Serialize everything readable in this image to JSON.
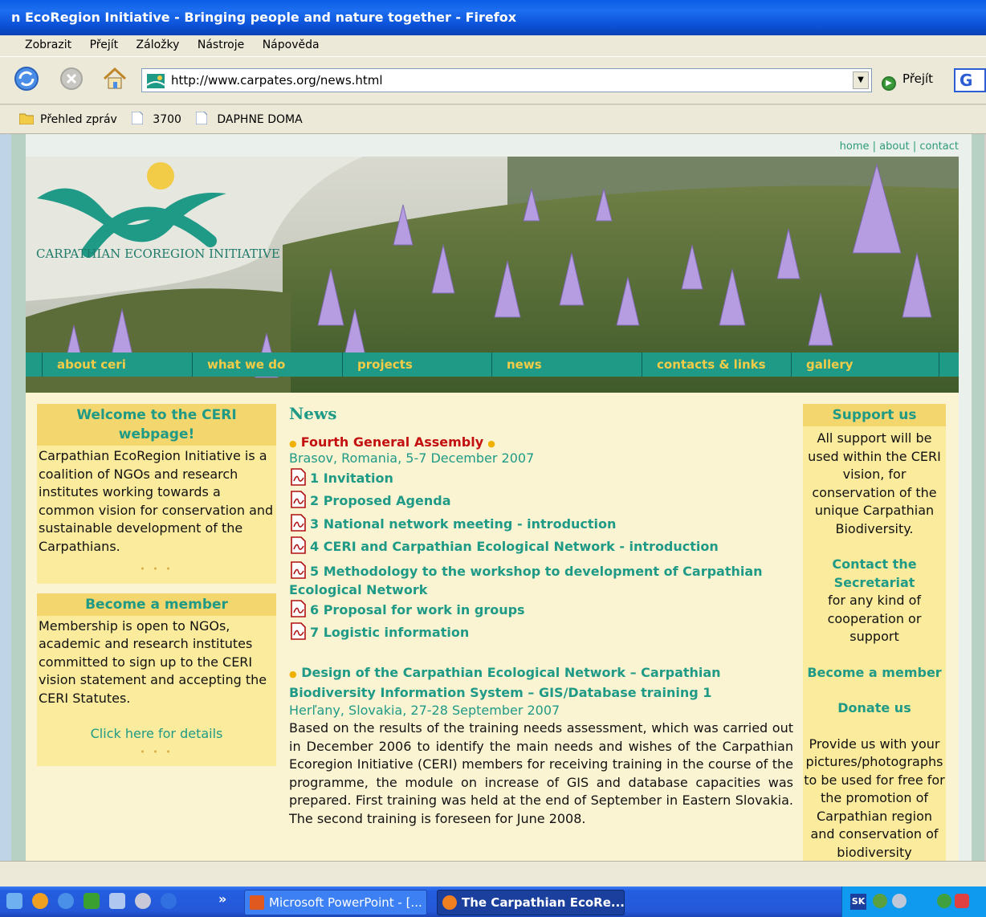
{
  "window": {
    "title": "n EcoRegion Initiative - Bringing people and nature together - Firefox"
  },
  "menu": [
    "Zobrazit",
    "Přejít",
    "Záložky",
    "Nástroje",
    "Nápověda"
  ],
  "toolbar": {
    "url": "http://www.carpates.org/news.html",
    "go_label": "Přejít",
    "google_label": "G"
  },
  "bookmarks": [
    "Přehled zpráv",
    "3700",
    "DAPHNE DOMA"
  ],
  "site": {
    "toplinks": {
      "home": "home",
      "sep1": " | ",
      "about": "about",
      "sep2": " | ",
      "contact": "contact"
    },
    "logo_text": "Carpathian EcoRegion Initiative",
    "tabs": [
      "about ceri",
      "what we do",
      "projects",
      "news",
      "contacts & links",
      "gallery"
    ],
    "welcome": {
      "title": "Welcome to the CERI webpage!",
      "text": "Carpathian EcoRegion Initiative is a coalition of NGOs and research institutes working towards a common vision for conservation and sustainable development of the Carpathians.",
      "dots": "• • •"
    },
    "member": {
      "title": "Become a member",
      "text": "Membership is open to NGOs, academic and research institutes committed to sign up to the CERI vision statement and accepting the CERI Statutes.",
      "link": "Click here for details",
      "dots": "• • •"
    },
    "news": {
      "title": "News",
      "item1": {
        "headline": "Fourth General Assembly",
        "place": "Brasov, Romania, 5-7 December 2007",
        "docs": [
          "1 Invitation",
          "2 Proposed Agenda",
          "3 National network meeting - introduction",
          "4 CERI and Carpathian Ecological Network - introduction",
          "5 Methodology to the workshop to development of Carpathian Ecological Network",
          "6 Proposal for work in groups",
          "7 Logistic information"
        ]
      },
      "item2": {
        "headline": "Design of the Carpathian Ecological Network – Carpathian Biodiversity Information System – GIS/Database training 1",
        "place": "Herľany, Slovakia, 27-28 September 2007",
        "text": "Based on the results of the training needs assessment, which was carried out in December 2006 to identify the main needs and wishes of the Carpathian Ecoregion Initiative (CERI) members for receiving training in the course of the programme, the module on increase of GIS and database capacities was prepared. First training was held at the end of September in Eastern Slovakia. The second training is foreseen for June 2008."
      }
    },
    "support": {
      "title": "Support us",
      "text1": "All support will be used within the CERI vision, for conservation of the unique Carpathian Biodiversity.",
      "contact_link": "Contact the Secretariat",
      "text2": "for any kind of cooperation or support",
      "member_link": "Become a member",
      "donate_link": "Donate us",
      "text3": "Provide us with your pictures/photographs to be used for free for the promotion of Carpathian region and conservation of biodiversity"
    }
  },
  "taskbar": {
    "chevron": "»",
    "tasks": [
      "Microsoft PowerPoint - [...",
      "The Carpathian EcoRe..."
    ],
    "tray_lang": "SK"
  },
  "colors": {
    "accent": "#1f9a86",
    "tab_text": "#f3cc47",
    "headline": "#c31010",
    "panel": "#fbeb9d",
    "panel_head": "#f3d76e"
  }
}
